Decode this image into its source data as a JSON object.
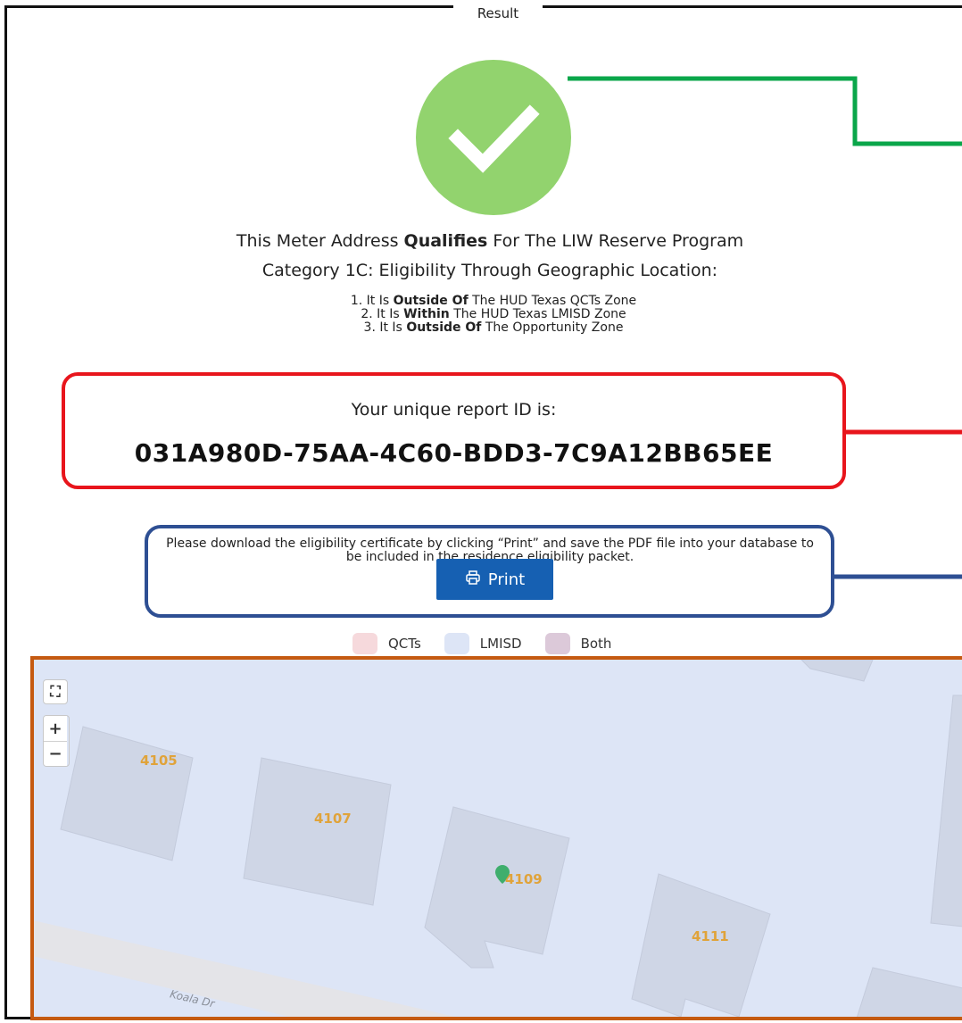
{
  "panel": {
    "title": "Result"
  },
  "result": {
    "status_icon": "check-icon",
    "status_color": "#92d36e",
    "line1_before": "This Meter Address ",
    "line1_strong": "Qualifies",
    "line1_after": " For The LIW Reserve Program",
    "line2": "Category 1C: Eligibility Through Geographic Location:",
    "criteria": [
      {
        "num": "1.",
        "before": "It Is ",
        "strong": "Outside Of",
        "after": " The HUD Texas QCTs Zone"
      },
      {
        "num": "2.",
        "before": "It Is ",
        "strong": "Within",
        "after": " The HUD Texas LMISD Zone"
      },
      {
        "num": "3.",
        "before": "It Is ",
        "strong": "Outside Of",
        "after": " The Opportunity Zone"
      }
    ]
  },
  "report": {
    "label": "Your unique report ID is:",
    "id": "031A980D-75AA-4C60-BDD3-7C9A12BB65EE"
  },
  "certificate": {
    "instructions": "Please download the eligibility certificate by clicking “Print” and save the PDF file into your database to be included in the residence eligibility packet.",
    "print_label": "Print",
    "print_icon": "printer-icon",
    "button_color": "#1660b2"
  },
  "legend": [
    {
      "label": "QCTs",
      "color": "#f6d9dc"
    },
    {
      "label": "LMISD",
      "color": "#dde5f6"
    },
    {
      "label": "Both",
      "color": "#dcc9d9"
    }
  ],
  "map": {
    "controls": {
      "expand_icon": "expand-icon",
      "zoom_in": "+",
      "zoom_out": "−"
    },
    "houses": [
      "4105",
      "4107",
      "4109",
      "4111"
    ],
    "street": "Koala Dr",
    "marker_color": "#3fae6d"
  },
  "annotation_colors": {
    "green": "#0aa64a",
    "red": "#e8151c",
    "blue": "#2e4f93",
    "orange": "#c55a11"
  }
}
